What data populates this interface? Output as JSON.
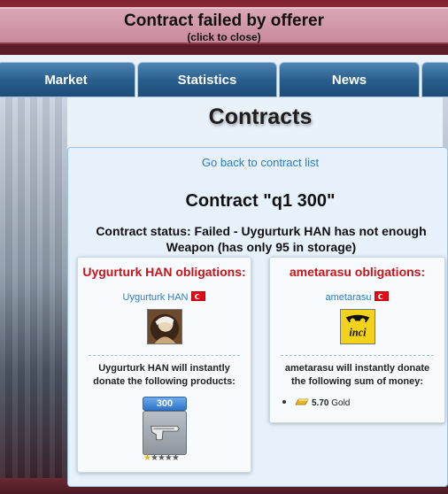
{
  "notification": {
    "title": "Contract failed by offerer",
    "subtitle": "(click to close)"
  },
  "nav": {
    "tabs": [
      {
        "label": "Market"
      },
      {
        "label": "Statistics"
      },
      {
        "label": "News"
      }
    ]
  },
  "page": {
    "title": "Contracts",
    "back_link": "Go back to contract list"
  },
  "contract": {
    "title": "Contract \"q1 300\"",
    "status": "Contract status: Failed - Uygurturk HAN has not enough Weapon (has only 95 in storage)"
  },
  "left_card": {
    "title": "Uygurturk HAN obligations:",
    "user": "Uygurturk HAN",
    "description": "Uygurturk HAN will instantly donate the following products:",
    "product": {
      "quantity": "300",
      "icon": "weapon-pistol-icon",
      "quality_stars": 1,
      "max_stars": 5
    }
  },
  "right_card": {
    "title": "ametarasu obligations:",
    "user": "ametarasu",
    "avatar_text": "inci",
    "description": "ametarasu will instantly donate the following sum of money:",
    "money": {
      "amount": "5.70",
      "currency": "Gold",
      "icon": "gold-bar-icon"
    }
  },
  "colors": {
    "accent_red": "#c8141a",
    "link_blue": "#2a7dc9",
    "nav_blue": "#2a5f8e",
    "turkey_flag": "#e30a17"
  }
}
